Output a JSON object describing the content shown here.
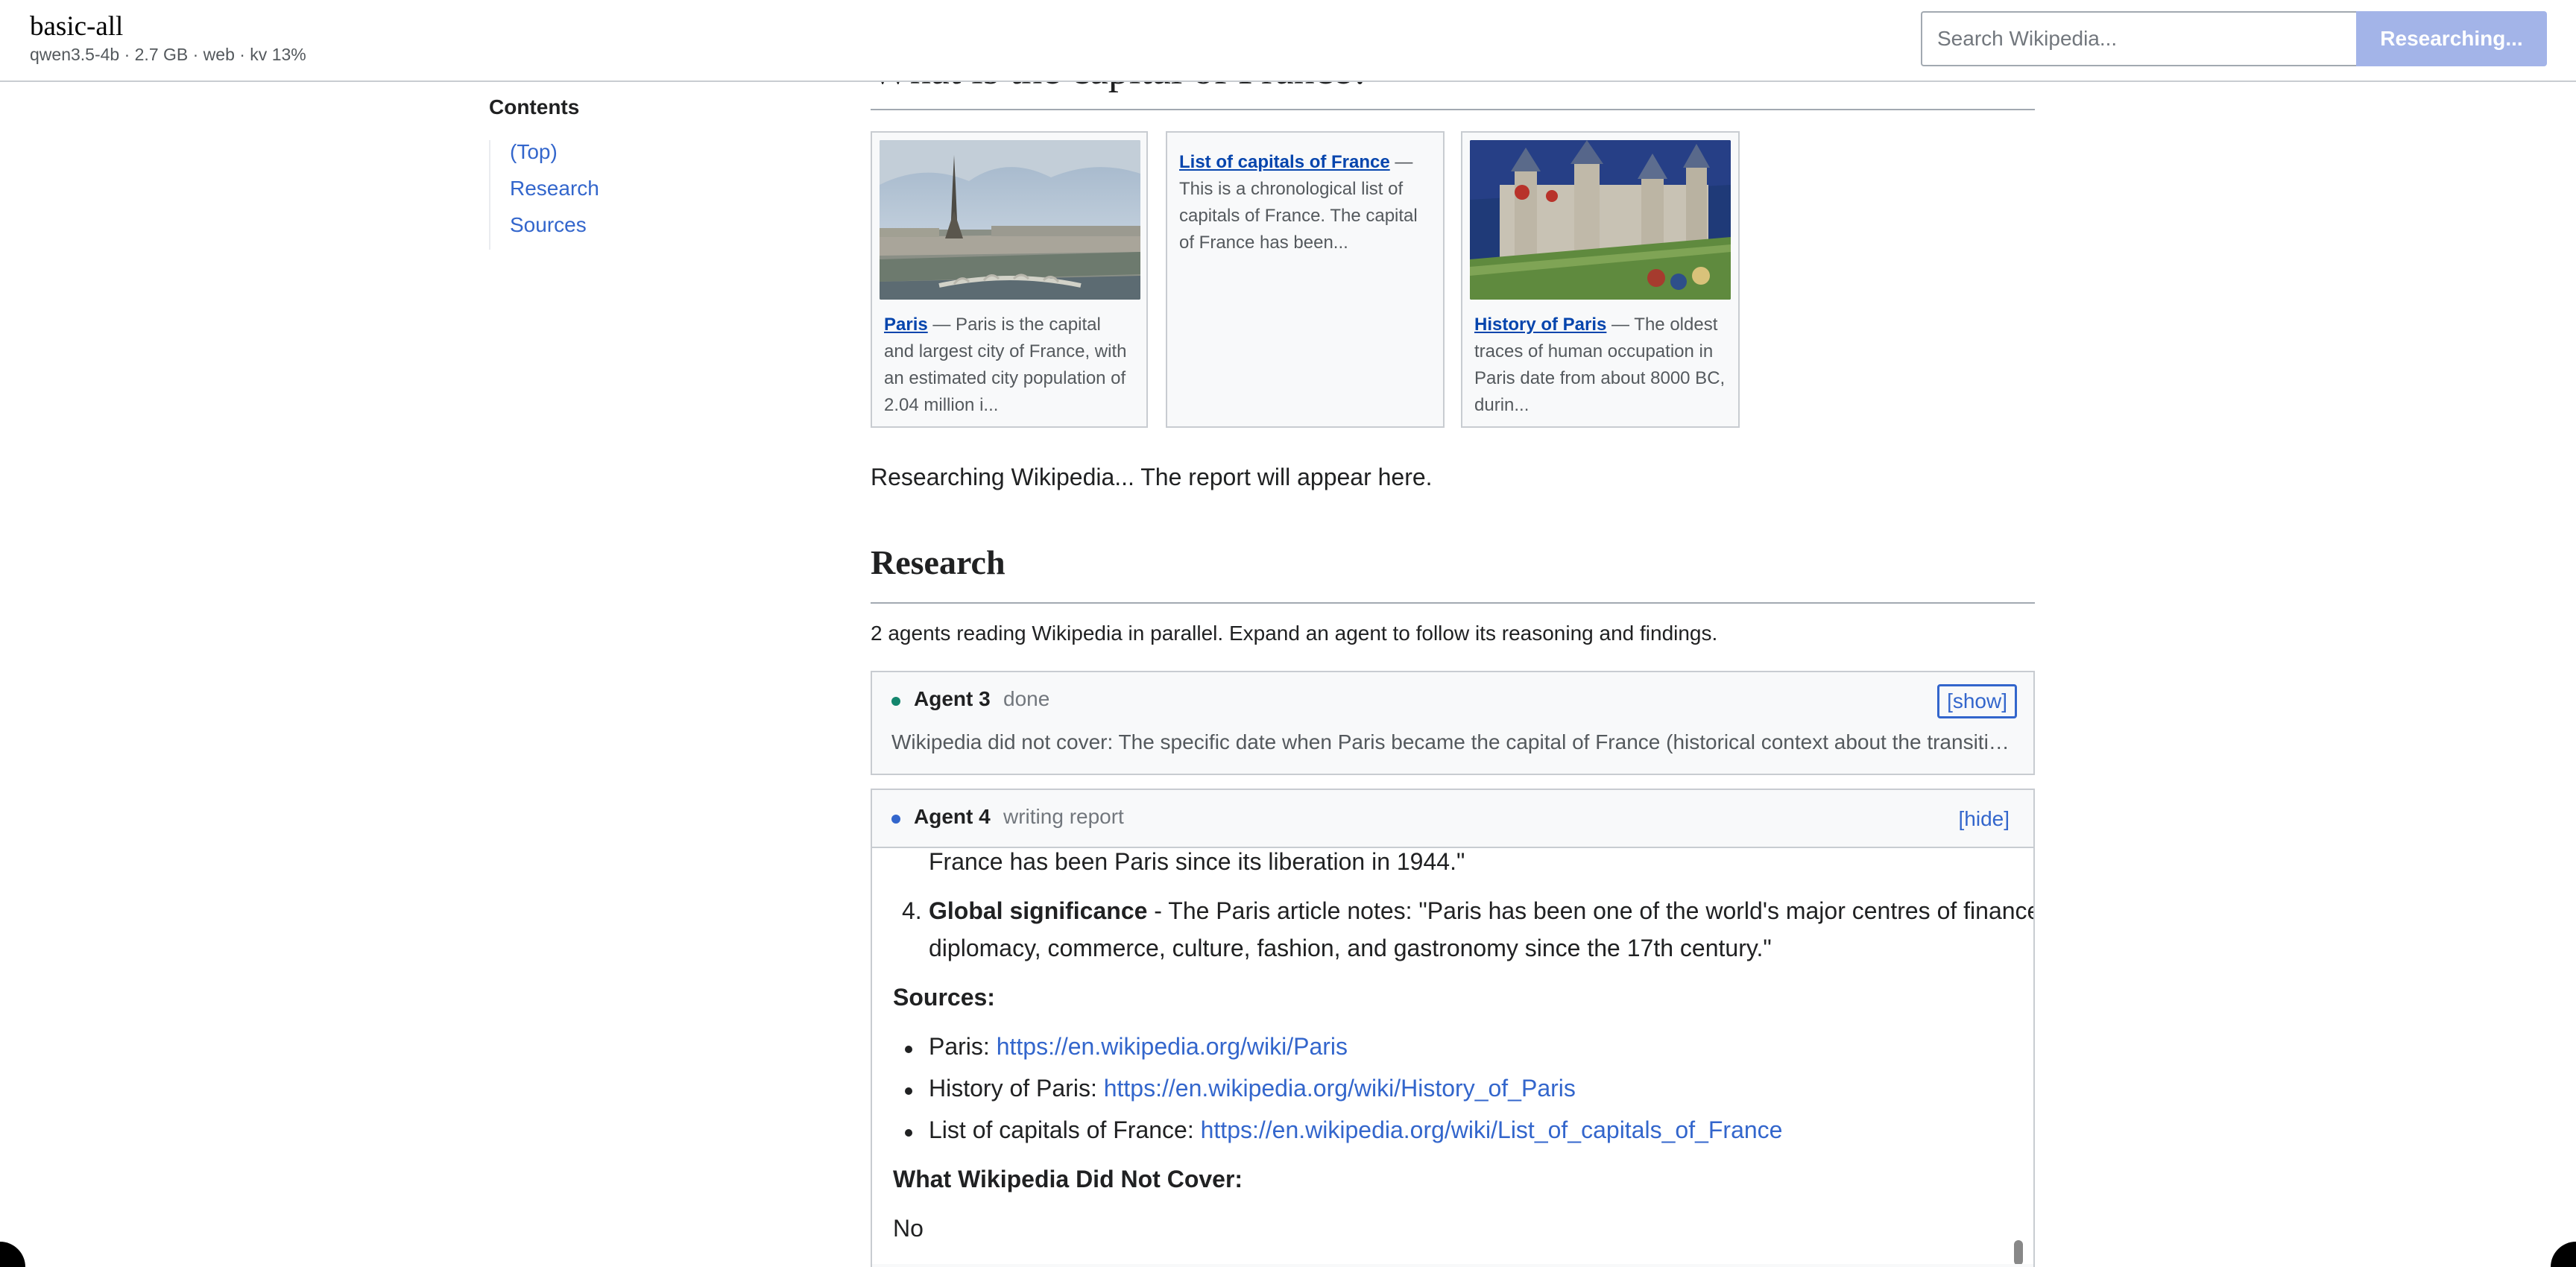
{
  "app": {
    "title": "basic-all",
    "meta": "qwen3.5-4b · 2.7 GB · web · kv 13%"
  },
  "search": {
    "placeholder": "Search Wikipedia...",
    "button_label": "Researching..."
  },
  "toc": {
    "title": "Contents",
    "items": [
      {
        "label": "(Top)"
      },
      {
        "label": "Research"
      },
      {
        "label": "Sources"
      }
    ]
  },
  "main": {
    "question_heading": "What is the capital of France?",
    "status": "Researching Wikipedia... The report will appear here.",
    "cards": [
      {
        "title": "Paris",
        "text": " — Paris is the capital and largest city of France, with an estimated city population of 2.04 million i...",
        "image_icon": "eiffel-tower-photo"
      },
      {
        "title": "List of capitals of France",
        "text": " — This is a chronological list of capitals of France. The capital of France has been..."
      },
      {
        "title": "History of Paris",
        "text": " — The oldest traces of human occupation in Paris date from about 8000 BC, durin...",
        "image_icon": "medieval-castle-painting"
      }
    ]
  },
  "research": {
    "heading": "Research",
    "intro": "2 agents reading Wikipedia in parallel. Expand an agent to follow its reasoning and findings.",
    "agents": [
      {
        "name": "Agent 3",
        "state": "done",
        "toggle": "[show]",
        "dot_color": "#14866d",
        "summary": "Wikipedia did not cover: The specific date when Paris became the capital of France (historical context about the transition …"
      },
      {
        "name": "Agent 4",
        "state": "writing report",
        "toggle": "[hide]",
        "dot_color": "#3366cc",
        "report": {
          "line_partial": "France has been Paris since its liberation in 1944.\"",
          "item4_number": "4.",
          "item4_bold": "Global significance",
          "item4_text": " - The Paris article notes: \"Paris has been one of the world's major centres of finance,",
          "item4_text_2": "diplomacy, commerce, culture, fashion, and gastronomy since the 17th century.\"",
          "sources_heading": "Sources:",
          "sources": [
            {
              "label": "Paris: ",
              "url": "https://en.wikipedia.org/wiki/Paris"
            },
            {
              "label": "History of Paris: ",
              "url": "https://en.wikipedia.org/wiki/History_of_Paris"
            },
            {
              "label": "List of capitals of France: ",
              "url": "https://en.wikipedia.org/wiki/List_of_capitals_of_France"
            }
          ],
          "not_covered_heading": "What Wikipedia Did Not Cover:",
          "not_covered_text": "No"
        }
      }
    ]
  }
}
